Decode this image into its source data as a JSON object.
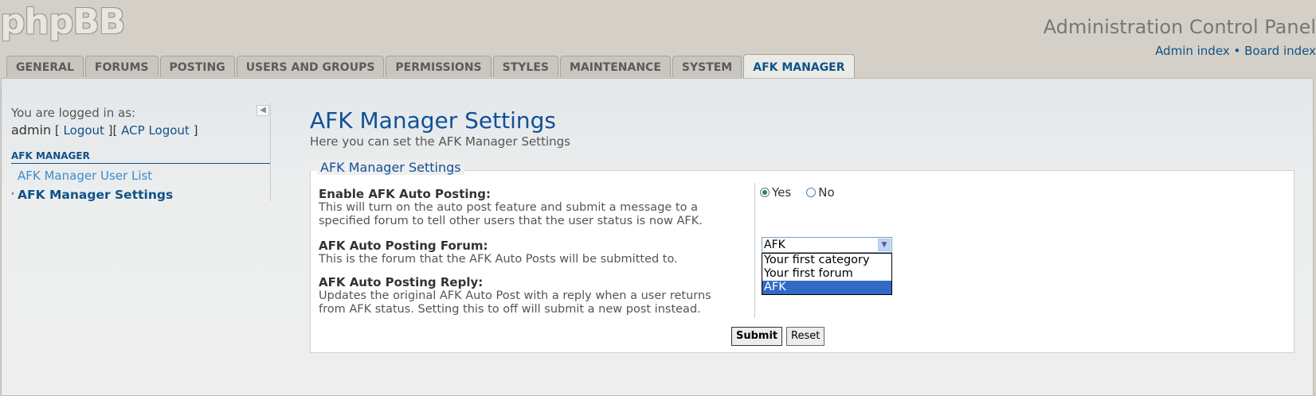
{
  "header": {
    "logo": "phpBB",
    "title": "Administration Control Panel",
    "links": {
      "admin_index": "Admin index",
      "separator": "•",
      "board_index": "Board index"
    }
  },
  "tabs": [
    {
      "label": "GENERAL"
    },
    {
      "label": "FORUMS"
    },
    {
      "label": "POSTING"
    },
    {
      "label": "USERS AND GROUPS"
    },
    {
      "label": "PERMISSIONS"
    },
    {
      "label": "STYLES"
    },
    {
      "label": "MAINTENANCE"
    },
    {
      "label": "SYSTEM"
    },
    {
      "label": "AFK MANAGER",
      "active": true
    }
  ],
  "sidebar": {
    "logged_in_label": "You are logged in as:",
    "username": "admin",
    "logout": "Logout",
    "acp_logout": "ACP Logout",
    "section_title": "AFK MANAGER",
    "items": [
      {
        "label": "AFK Manager User List"
      },
      {
        "label": "AFK Manager Settings",
        "active": true
      }
    ]
  },
  "main": {
    "title": "AFK Manager Settings",
    "description": "Here you can set the AFK Manager Settings",
    "fieldset_legend": "AFK Manager Settings",
    "settings": [
      {
        "label": "Enable AFK Auto Posting:",
        "explain": "This will turn on the auto post feature and submit a message to a specified forum to tell other users that the user status is now AFK.",
        "options": [
          "Yes",
          "No"
        ],
        "selected": "Yes"
      },
      {
        "label": "AFK Auto Posting Forum:",
        "explain": "This is the forum that the AFK Auto Posts will be submitted to.",
        "selected": "AFK",
        "options": [
          "Your first category",
          "Your first forum",
          "AFK"
        ]
      },
      {
        "label": "AFK Auto Posting Reply:",
        "explain": "Updates the original AFK Auto Post with a reply when a user returns from AFK status. Setting this to off will submit a new post instead."
      }
    ],
    "buttons": {
      "submit": "Submit",
      "reset": "Reset"
    }
  },
  "colors": {
    "background": "#d4d0c8",
    "accent": "#105289",
    "selection": "#316ac5"
  }
}
